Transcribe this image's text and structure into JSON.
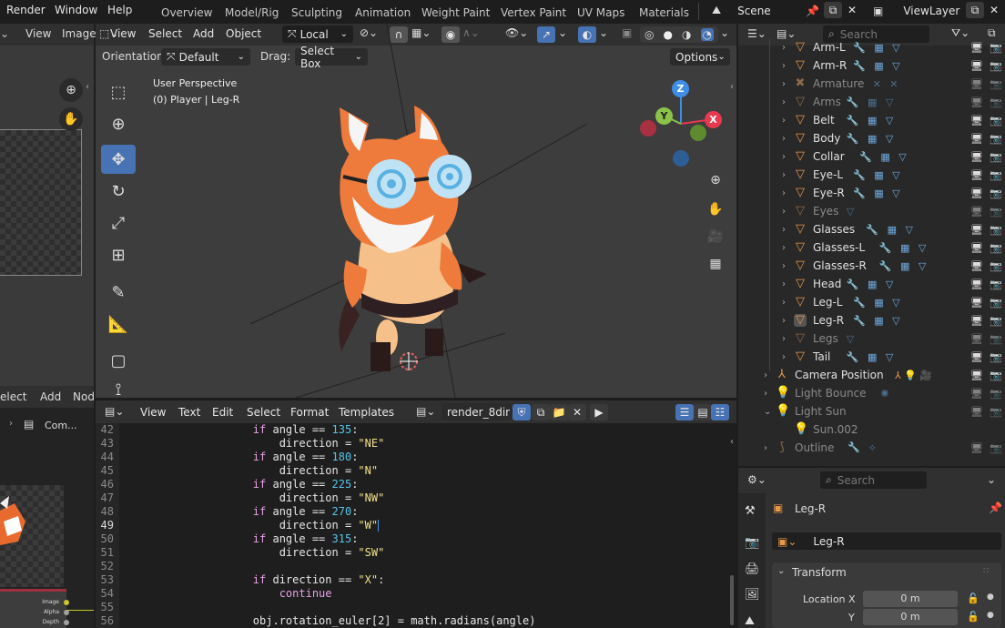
{
  "topbar": {
    "menus": [
      "Render",
      "Window",
      "Help"
    ],
    "workspaces": [
      "Overview",
      "Model/Rig",
      "Sculpting",
      "Animation",
      "Weight Paint",
      "Vertex Paint",
      "UV Maps",
      "Materials"
    ],
    "scene": "Scene",
    "view_layer": "ViewLayer"
  },
  "left_editor": {
    "menus": [
      "View",
      "Image"
    ],
    "node_menus": [
      "elect",
      "Add",
      "Nod"
    ],
    "tree_item": "Com...",
    "node_sockets": [
      "Image",
      "Alpha",
      "Depth"
    ]
  },
  "viewport": {
    "menus": [
      "View",
      "Select",
      "Add",
      "Object"
    ],
    "transform_orientation": "Local",
    "orientation_label": "Orientation:",
    "orientation_value": "Default",
    "drag_label": "Drag:",
    "drag_value": "Select Box",
    "options_label": "Options",
    "overlay_title": "User Perspective",
    "overlay_subtitle": "(0) Player | Leg-R",
    "gizmo_axes": [
      "Z",
      "Y",
      "X"
    ]
  },
  "text_editor": {
    "menus": [
      "View",
      "Text",
      "Edit",
      "Select",
      "Format",
      "Templates"
    ],
    "file_name": "render_8dir",
    "current_line": "49",
    "lines": [
      {
        "n": "42",
        "indent": "        ",
        "kw": "if",
        "rest1": " angle == ",
        "num": "135",
        "rest2": ":",
        "str": ""
      },
      {
        "n": "43",
        "indent": "            ",
        "kw": "",
        "rest1": "direction = ",
        "num": "",
        "rest2": "",
        "str": "\"NE\""
      },
      {
        "n": "44",
        "indent": "        ",
        "kw": "if",
        "rest1": " angle == ",
        "num": "180",
        "rest2": ":",
        "str": ""
      },
      {
        "n": "45",
        "indent": "            ",
        "kw": "",
        "rest1": "direction = ",
        "num": "",
        "rest2": "",
        "str": "\"N\""
      },
      {
        "n": "46",
        "indent": "        ",
        "kw": "if",
        "rest1": " angle == ",
        "num": "225",
        "rest2": ":",
        "str": ""
      },
      {
        "n": "47",
        "indent": "            ",
        "kw": "",
        "rest1": "direction = ",
        "num": "",
        "rest2": "",
        "str": "\"NW\""
      },
      {
        "n": "48",
        "indent": "        ",
        "kw": "if",
        "rest1": " angle == ",
        "num": "270",
        "rest2": ":",
        "str": ""
      },
      {
        "n": "49",
        "indent": "            ",
        "kw": "",
        "rest1": "direction = ",
        "num": "",
        "rest2": "",
        "str": "\"W\""
      },
      {
        "n": "50",
        "indent": "        ",
        "kw": "if",
        "rest1": " angle == ",
        "num": "315",
        "rest2": ":",
        "str": ""
      },
      {
        "n": "51",
        "indent": "            ",
        "kw": "",
        "rest1": "direction = ",
        "num": "",
        "rest2": "",
        "str": "\"SW\""
      },
      {
        "n": "52",
        "indent": "",
        "kw": "",
        "rest1": "",
        "num": "",
        "rest2": "",
        "str": ""
      },
      {
        "n": "53",
        "indent": "        ",
        "kw": "if",
        "rest1": " direction == ",
        "num": "",
        "rest2": ":",
        "str": "\"X\""
      },
      {
        "n": "54",
        "indent": "            ",
        "kw": "continue",
        "rest1": "",
        "num": "",
        "rest2": "",
        "str": ""
      },
      {
        "n": "55",
        "indent": "",
        "kw": "",
        "rest1": "",
        "num": "",
        "rest2": "",
        "str": ""
      },
      {
        "n": "56",
        "indent": "        ",
        "kw": "",
        "rest1": "obj.rotation_euler[2] = math.radians(angle)",
        "num": "",
        "rest2": "",
        "str": ""
      }
    ]
  },
  "outliner": {
    "search_placeholder": "Search",
    "rows": [
      {
        "label": "Arm-L",
        "type": "mesh",
        "dim": false,
        "mods": "🔧 ▦ ▽",
        "level": 1
      },
      {
        "label": "Arm-R",
        "type": "mesh",
        "dim": false,
        "mods": "🔧 ▦ ▽",
        "level": 1
      },
      {
        "label": "Armature",
        "type": "armature",
        "dim": true,
        "mods": "✕ ✕",
        "level": 1
      },
      {
        "label": "Arms",
        "type": "mesh",
        "dim": true,
        "mods": "🔧 ▦ ▽",
        "level": 1
      },
      {
        "label": "Belt",
        "type": "mesh",
        "dim": false,
        "mods": "🔧 ▦ ▽",
        "level": 1
      },
      {
        "label": "Body",
        "type": "mesh",
        "dim": false,
        "mods": "🔧 ▦ ▽",
        "level": 1
      },
      {
        "label": "Collar",
        "type": "mesh",
        "dim": false,
        "mods": "🔧 ▦ ▽",
        "level": 1
      },
      {
        "label": "Eye-L",
        "type": "mesh",
        "dim": false,
        "mods": "🔧 ▦ ▽",
        "level": 1
      },
      {
        "label": "Eye-R",
        "type": "mesh",
        "dim": false,
        "mods": "🔧 ▦ ▽",
        "level": 1
      },
      {
        "label": "Eyes",
        "type": "mesh",
        "dim": true,
        "mods": "▽",
        "level": 1
      },
      {
        "label": "Glasses",
        "type": "mesh",
        "dim": false,
        "mods": "🔧 ▦ ▽",
        "level": 1
      },
      {
        "label": "Glasses-L",
        "type": "mesh",
        "dim": false,
        "mods": "🔧 ▦ ▽",
        "level": 1
      },
      {
        "label": "Glasses-R",
        "type": "mesh",
        "dim": false,
        "mods": "🔧 ▦ ▽",
        "level": 1
      },
      {
        "label": "Head",
        "type": "mesh",
        "dim": false,
        "mods": "🔧 ▦ ▽",
        "level": 1
      },
      {
        "label": "Leg-L",
        "type": "mesh",
        "dim": false,
        "mods": "🔧 ▦ ▽",
        "level": 1
      },
      {
        "label": "Leg-R",
        "type": "mesh",
        "dim": false,
        "mods": "🔧 ▦ ▽",
        "level": 1,
        "active": true
      },
      {
        "label": "Legs",
        "type": "mesh",
        "dim": true,
        "mods": "▽",
        "level": 1
      },
      {
        "label": "Tail",
        "type": "mesh",
        "dim": false,
        "mods": "🔧 ▦ ▽",
        "level": 1
      },
      {
        "label": "Camera Position",
        "type": "empty",
        "dim": false,
        "mods": "",
        "level": 0
      },
      {
        "label": "Light Bounce",
        "type": "light",
        "dim": true,
        "mods": "✺",
        "level": 0
      },
      {
        "label": "Light Sun",
        "type": "light",
        "dim": true,
        "mods": "",
        "level": 0,
        "expanded": true
      },
      {
        "label": "Sun.002",
        "type": "light",
        "dim": true,
        "mods": "",
        "level": 1
      },
      {
        "label": "Outline",
        "type": "curve",
        "dim": true,
        "mods": "🔧 ⟡",
        "level": 0
      }
    ]
  },
  "properties": {
    "search_placeholder": "Search",
    "object_name": "Leg-R",
    "data_name": "Leg-R",
    "panel_title": "Transform",
    "location_x_label": "Location X",
    "location_x_value": "0 m",
    "location_y_label": "Y",
    "location_y_value": "0 m"
  },
  "colors": {
    "accent": "#4772b3",
    "mesh_icon": "#e8974b",
    "modifier": "#6fa8dc",
    "vgroup": "#31d6b5",
    "axis_x": "#e8394f",
    "axis_y": "#8bc34a",
    "axis_z": "#3e8ee8"
  }
}
